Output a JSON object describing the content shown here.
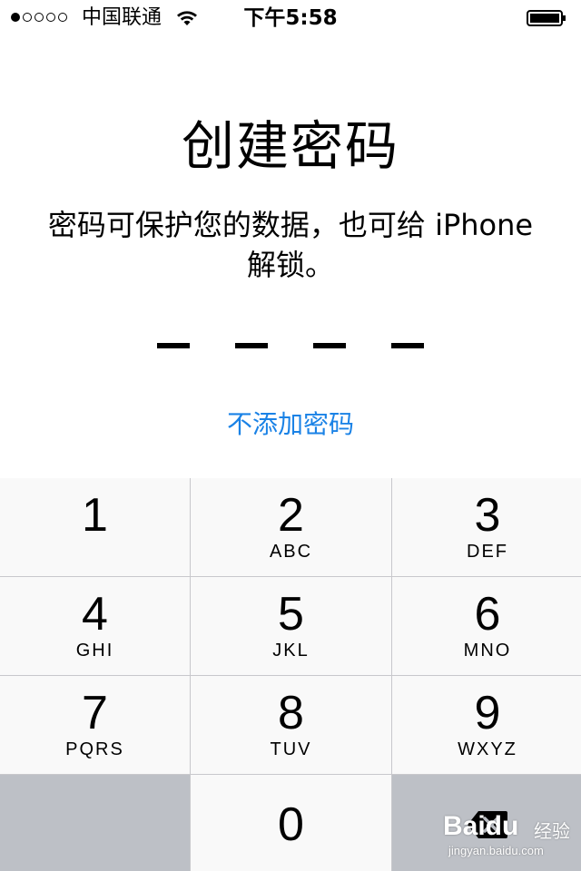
{
  "status_bar": {
    "signal_filled": 1,
    "signal_total": 5,
    "carrier": "中国联通",
    "wifi_icon": "wifi-icon",
    "time": "下午5:58",
    "battery_icon": "battery-icon",
    "battery_level": 0.95
  },
  "main": {
    "title": "创建密码",
    "subtitle_line1": "密码可保护您的数据，也可给 iPhone",
    "subtitle_line2": "解锁。",
    "passcode_length": 4,
    "skip_link": "不添加密码",
    "link_color": "#1a82e6"
  },
  "keypad": {
    "keys": [
      {
        "digit": "1",
        "letters": ""
      },
      {
        "digit": "2",
        "letters": "ABC"
      },
      {
        "digit": "3",
        "letters": "DEF"
      },
      {
        "digit": "4",
        "letters": "GHI"
      },
      {
        "digit": "5",
        "letters": "JKL"
      },
      {
        "digit": "6",
        "letters": "MNO"
      },
      {
        "digit": "7",
        "letters": "PQRS"
      },
      {
        "digit": "8",
        "letters": "TUV"
      },
      {
        "digit": "9",
        "letters": "WXYZ"
      }
    ],
    "zero": "0",
    "delete_icon": "backspace-icon"
  },
  "watermark": {
    "logo": "Baidu",
    "label": "经验",
    "url": "jingyan.baidu.com"
  }
}
